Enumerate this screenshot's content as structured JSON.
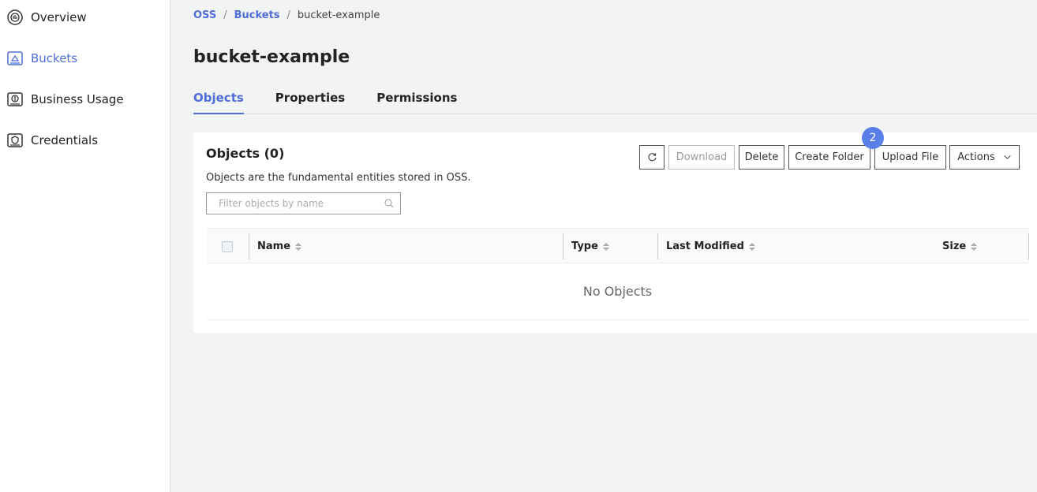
{
  "sidebar": {
    "items": [
      {
        "label": "Overview",
        "icon": "overview-icon",
        "active": false
      },
      {
        "label": "Buckets",
        "icon": "bucket-icon",
        "active": true
      },
      {
        "label": "Business Usage",
        "icon": "business-usage-icon",
        "active": false
      },
      {
        "label": "Credentials",
        "icon": "credentials-icon",
        "active": false
      }
    ]
  },
  "breadcrumb": {
    "root": "OSS",
    "sep": "/",
    "buckets": "Buckets",
    "current": "bucket-example"
  },
  "page": {
    "title": "bucket-example"
  },
  "tabs": [
    {
      "label": "Objects",
      "active": true
    },
    {
      "label": "Properties",
      "active": false
    },
    {
      "label": "Permissions",
      "active": false
    }
  ],
  "panel": {
    "title": "Objects (0)",
    "description": "Objects are the fundamental entities stored in OSS.",
    "filter_placeholder": "Filter objects by name"
  },
  "toolbar": {
    "download": "Download",
    "delete": "Delete",
    "create_folder": "Create Folder",
    "upload_file": "Upload File",
    "actions": "Actions",
    "badge": "2"
  },
  "table": {
    "columns": [
      "Name",
      "Type",
      "Last Modified",
      "Size"
    ],
    "empty": "No Objects"
  },
  "colors": {
    "accent": "#4e6ed9",
    "badge": "#5b7fe8"
  }
}
